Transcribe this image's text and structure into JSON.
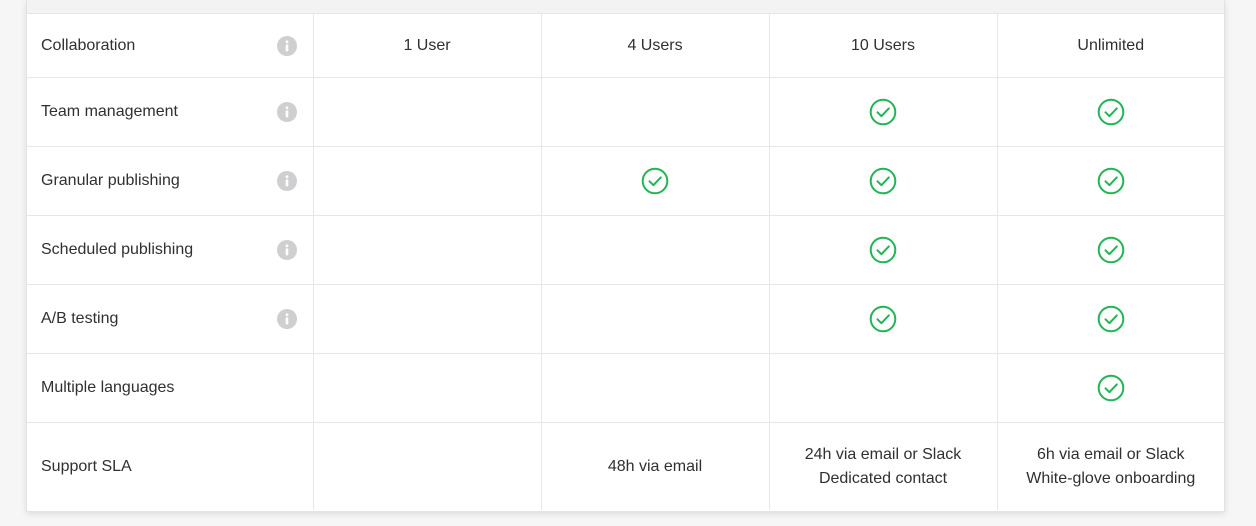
{
  "colors": {
    "accent_check": "#22b455",
    "info_icon": "#cfcfd2",
    "border": "#e6e7ea",
    "text": "#2f3033"
  },
  "rows": [
    {
      "feature": "Collaboration",
      "info_icon": "info-icon",
      "cells": [
        {
          "text": "1 User"
        },
        {
          "text": "4 Users"
        },
        {
          "text": "10 Users"
        },
        {
          "text": "Unlimited"
        }
      ]
    },
    {
      "feature": "Team management",
      "info_icon": "info-icon",
      "cells": [
        {
          "check": false
        },
        {
          "check": false
        },
        {
          "check": true
        },
        {
          "check": true
        }
      ]
    },
    {
      "feature": "Granular publishing",
      "info_icon": "info-icon",
      "cells": [
        {
          "check": false
        },
        {
          "check": true
        },
        {
          "check": true
        },
        {
          "check": true
        }
      ]
    },
    {
      "feature": "Scheduled publishing",
      "info_icon": "info-icon",
      "cells": [
        {
          "check": false
        },
        {
          "check": false
        },
        {
          "check": true
        },
        {
          "check": true
        }
      ]
    },
    {
      "feature": "A/B testing",
      "info_icon": "info-icon",
      "cells": [
        {
          "check": false
        },
        {
          "check": false
        },
        {
          "check": true
        },
        {
          "check": true
        }
      ]
    },
    {
      "feature": "Multiple languages",
      "cells": [
        {
          "check": false
        },
        {
          "check": false
        },
        {
          "check": false
        },
        {
          "check": true
        }
      ]
    },
    {
      "feature": "Support SLA",
      "cells": [
        {
          "text": ""
        },
        {
          "text": "48h via email"
        },
        {
          "text": "24h via email or Slack\nDedicated contact"
        },
        {
          "text": "6h via email or Slack\nWhite-glove onboarding"
        }
      ]
    }
  ]
}
